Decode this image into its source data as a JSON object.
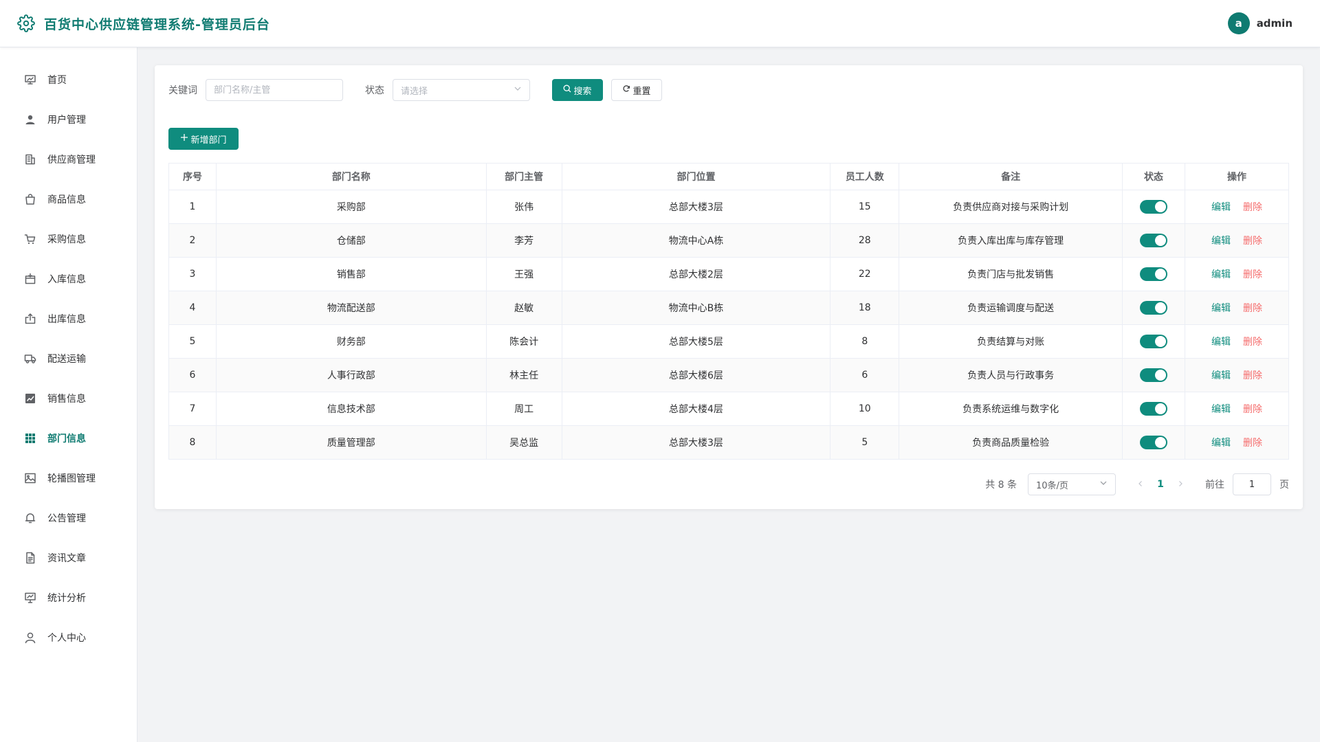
{
  "header": {
    "title": "百货中心供应链管理系统-管理员后台",
    "avatar_letter": "a",
    "username": "admin",
    "brand_color": "#0f7b71"
  },
  "sidebar": {
    "items": [
      {
        "label": "首页",
        "icon": "home-board-icon"
      },
      {
        "label": "用户管理",
        "icon": "user-icon"
      },
      {
        "label": "供应商管理",
        "icon": "building-icon"
      },
      {
        "label": "商品信息",
        "icon": "shopping-bag-icon"
      },
      {
        "label": "采购信息",
        "icon": "cart-icon"
      },
      {
        "label": "入库信息",
        "icon": "box-in-icon"
      },
      {
        "label": "出库信息",
        "icon": "box-out-icon"
      },
      {
        "label": "配送运输",
        "icon": "truck-icon"
      },
      {
        "label": "销售信息",
        "icon": "chart-icon"
      },
      {
        "label": "部门信息",
        "icon": "grid-icon",
        "active": true
      },
      {
        "label": "轮播图管理",
        "icon": "image-icon"
      },
      {
        "label": "公告管理",
        "icon": "bell-icon"
      },
      {
        "label": "资讯文章",
        "icon": "document-icon"
      },
      {
        "label": "统计分析",
        "icon": "presentation-icon"
      },
      {
        "label": "个人中心",
        "icon": "person-icon"
      }
    ]
  },
  "filters": {
    "keyword_label": "关键词",
    "keyword_placeholder": "部门名称/主管",
    "status_label": "状态",
    "status_placeholder": "请选择",
    "search_label": "搜索",
    "reset_label": "重置"
  },
  "add_button_label": "新增部门",
  "table": {
    "columns": [
      "序号",
      "部门名称",
      "部门主管",
      "部门位置",
      "员工人数",
      "备注",
      "状态",
      "操作"
    ],
    "edit_label": "编辑",
    "delete_label": "删除",
    "rows": [
      {
        "no": "1",
        "name": "采购部",
        "manager": "张伟",
        "location": "总部大楼3层",
        "staff": "15",
        "note": "负责供应商对接与采购计划",
        "enabled": true
      },
      {
        "no": "2",
        "name": "仓储部",
        "manager": "李芳",
        "location": "物流中心A栋",
        "staff": "28",
        "note": "负责入库出库与库存管理",
        "enabled": true
      },
      {
        "no": "3",
        "name": "销售部",
        "manager": "王强",
        "location": "总部大楼2层",
        "staff": "22",
        "note": "负责门店与批发销售",
        "enabled": true
      },
      {
        "no": "4",
        "name": "物流配送部",
        "manager": "赵敏",
        "location": "物流中心B栋",
        "staff": "18",
        "note": "负责运输调度与配送",
        "enabled": true
      },
      {
        "no": "5",
        "name": "财务部",
        "manager": "陈会计",
        "location": "总部大楼5层",
        "staff": "8",
        "note": "负责结算与对账",
        "enabled": true
      },
      {
        "no": "6",
        "name": "人事行政部",
        "manager": "林主任",
        "location": "总部大楼6层",
        "staff": "6",
        "note": "负责人员与行政事务",
        "enabled": true
      },
      {
        "no": "7",
        "name": "信息技术部",
        "manager": "周工",
        "location": "总部大楼4层",
        "staff": "10",
        "note": "负责系统运维与数字化",
        "enabled": true
      },
      {
        "no": "8",
        "name": "质量管理部",
        "manager": "吴总监",
        "location": "总部大楼3层",
        "staff": "5",
        "note": "负责商品质量检验",
        "enabled": true
      }
    ]
  },
  "pagination": {
    "total_text": "共 8 条",
    "page_size": "10条/页",
    "current_page": "1",
    "goto_label": "前往",
    "goto_value": "1",
    "page_unit": "页"
  }
}
